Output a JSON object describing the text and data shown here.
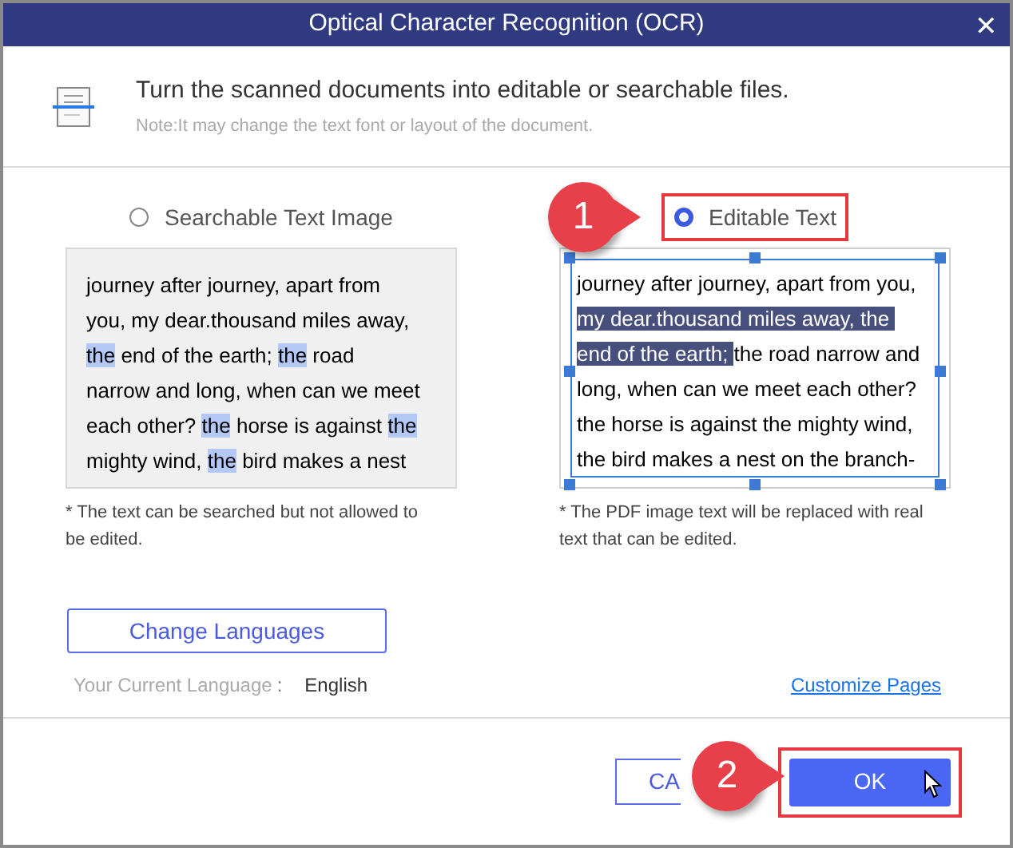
{
  "window": {
    "title": "Optical Character Recognition (OCR)",
    "close": "✕"
  },
  "header": {
    "heading": "Turn the scanned documents into editable or searchable files.",
    "note": "Note:It may change the text font or layout of the document."
  },
  "options": [
    {
      "kind": "image",
      "label": "Searchable Text Image",
      "selected": false,
      "note": "* The text can be searched but not allowed to be edited.",
      "lines": [
        [
          {
            "text": "journey after journey, apart from",
            "highlighted": false
          }
        ],
        [
          {
            "text": "you, my dear.thousand miles away,",
            "highlighted": false
          }
        ],
        [
          {
            "text": "the",
            "highlighted": true
          },
          {
            "text": " end of the earth; ",
            "highlighted": false
          },
          {
            "text": "the",
            "highlighted": true
          },
          {
            "text": " road",
            "highlighted": false
          }
        ],
        [
          {
            "text": "narrow and long, when can we meet",
            "highlighted": false
          }
        ],
        [
          {
            "text": "each other? ",
            "highlighted": false
          },
          {
            "text": "the",
            "highlighted": true
          },
          {
            "text": " horse is against ",
            "highlighted": false
          },
          {
            "text": "the",
            "highlighted": true
          }
        ],
        [
          {
            "text": "mighty wind, ",
            "highlighted": false
          },
          {
            "text": "the",
            "highlighted": true
          },
          {
            "text": " bird makes a nest",
            "highlighted": false
          }
        ]
      ]
    },
    {
      "kind": "editable",
      "label": "Editable Text",
      "selected": true,
      "note": "* The PDF image text will be replaced with real text that can be edited.",
      "lines": [
        [
          {
            "text": "journey after journey, apart from you,",
            "highlighted": false
          }
        ],
        [
          {
            "text": "my dear.thousand miles away, the ",
            "highlighted": true
          }
        ],
        [
          {
            "text": "end of the earth; ",
            "highlighted": true
          },
          {
            "text": "the road narrow and",
            "highlighted": false
          }
        ],
        [
          {
            "text": "long, when can we meet each other?",
            "highlighted": false
          }
        ],
        [
          {
            "text": "the horse is against the mighty wind,",
            "highlighted": false
          }
        ],
        [
          {
            "text": "the bird makes a nest on the branch-",
            "highlighted": false
          }
        ]
      ]
    }
  ],
  "language": {
    "button": "Change Languages",
    "label": "Your Current Language",
    "separator": ":",
    "value": "English"
  },
  "customize_link": "Customize Pages",
  "footer": {
    "cancel": "CA",
    "ok": "OK"
  },
  "callouts": [
    {
      "number": "1"
    },
    {
      "number": "2"
    }
  ]
}
